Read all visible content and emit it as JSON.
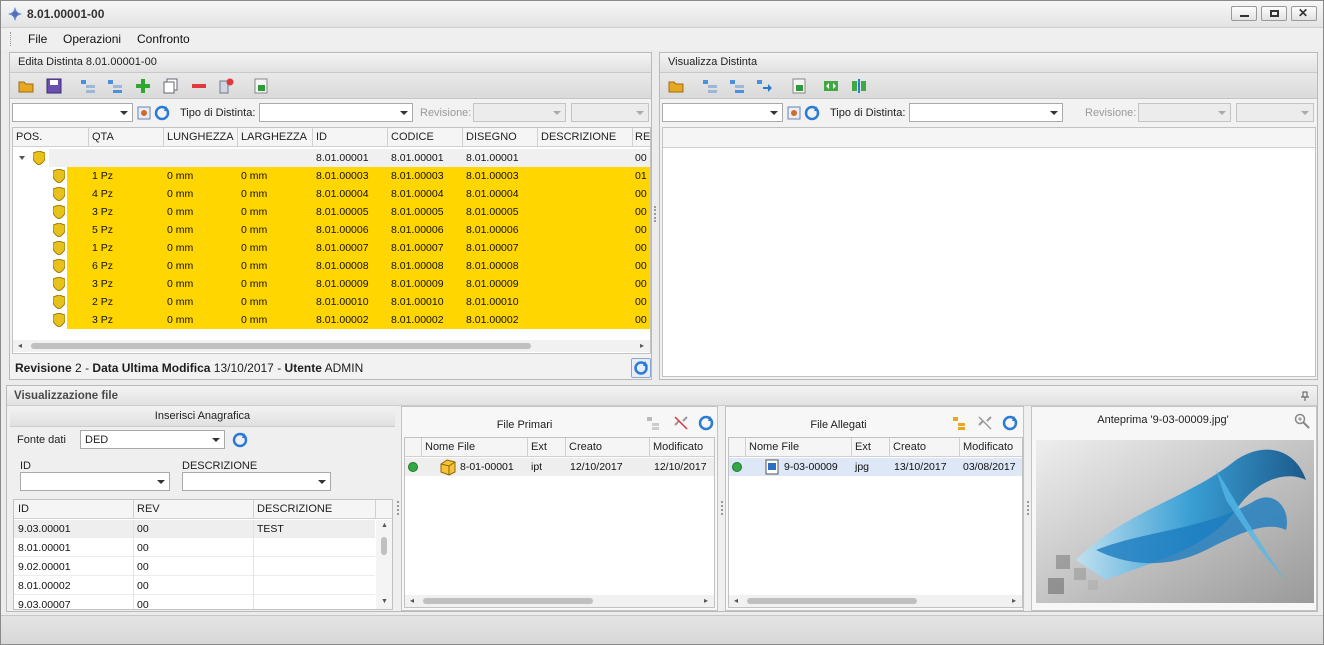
{
  "window": {
    "title": "8.01.00001-00"
  },
  "menu": [
    "File",
    "Operazioni",
    "Confronto"
  ],
  "left_panel": {
    "title": "Edita Distinta 8.01.00001-00",
    "tipo_label": "Tipo di Distinta:",
    "revisione_label": "Revisione:",
    "columns": [
      "POS.",
      "QTA",
      "LUNGHEZZA",
      "LARGHEZZA",
      "ID",
      "CODICE",
      "DISEGNO",
      "DESCRIZIONE",
      "REV"
    ],
    "root": {
      "id": "8.01.00001",
      "codice": "8.01.00001",
      "disegno": "8.01.00001",
      "rev": "00"
    },
    "rows": [
      {
        "qta": "1 Pz",
        "lung": "0 mm",
        "larg": "0 mm",
        "id": "8.01.00003",
        "codice": "8.01.00003",
        "disegno": "8.01.00003",
        "rev": "01"
      },
      {
        "qta": "4 Pz",
        "lung": "0 mm",
        "larg": "0 mm",
        "id": "8.01.00004",
        "codice": "8.01.00004",
        "disegno": "8.01.00004",
        "rev": "00"
      },
      {
        "qta": "3 Pz",
        "lung": "0 mm",
        "larg": "0 mm",
        "id": "8.01.00005",
        "codice": "8.01.00005",
        "disegno": "8.01.00005",
        "rev": "00"
      },
      {
        "qta": "5 Pz",
        "lung": "0 mm",
        "larg": "0 mm",
        "id": "8.01.00006",
        "codice": "8.01.00006",
        "disegno": "8.01.00006",
        "rev": "00"
      },
      {
        "qta": "1 Pz",
        "lung": "0 mm",
        "larg": "0 mm",
        "id": "8.01.00007",
        "codice": "8.01.00007",
        "disegno": "8.01.00007",
        "rev": "00"
      },
      {
        "qta": "6 Pz",
        "lung": "0 mm",
        "larg": "0 mm",
        "id": "8.01.00008",
        "codice": "8.01.00008",
        "disegno": "8.01.00008",
        "rev": "00"
      },
      {
        "qta": "3 Pz",
        "lung": "0 mm",
        "larg": "0 mm",
        "id": "8.01.00009",
        "codice": "8.01.00009",
        "disegno": "8.01.00009",
        "rev": "00"
      },
      {
        "qta": "2 Pz",
        "lung": "0 mm",
        "larg": "0 mm",
        "id": "8.01.00010",
        "codice": "8.01.00010",
        "disegno": "8.01.00010",
        "rev": "00"
      },
      {
        "qta": "3 Pz",
        "lung": "0 mm",
        "larg": "0 mm",
        "id": "8.01.00002",
        "codice": "8.01.00002",
        "disegno": "8.01.00002",
        "rev": "00"
      }
    ],
    "status": {
      "rev_label": "Revisione",
      "rev_value": "2",
      "date_label": "Data Ultima Modifica",
      "date_value": "13/10/2017",
      "user_label": "Utente",
      "user_value": "ADMIN",
      "sep": "-"
    }
  },
  "right_panel": {
    "title": "Visualizza Distinta",
    "tipo_label": "Tipo di Distinta:",
    "revisione_label": "Revisione:"
  },
  "file_section": {
    "title": "Visualizzazione file",
    "anagrafica": {
      "title": "Inserisci Anagrafica",
      "fonte_label": "Fonte dati",
      "fonte_value": "DED",
      "id_label": "ID",
      "desc_label": "DESCRIZIONE",
      "columns": [
        "ID",
        "REV",
        "DESCRIZIONE"
      ],
      "rows": [
        {
          "id": "9.03.00001",
          "rev": "00",
          "desc": "TEST"
        },
        {
          "id": "8.01.00001",
          "rev": "00",
          "desc": ""
        },
        {
          "id": "9.02.00001",
          "rev": "00",
          "desc": ""
        },
        {
          "id": "8.01.00002",
          "rev": "00",
          "desc": ""
        },
        {
          "id": "9.03.00007",
          "rev": "00",
          "desc": ""
        }
      ]
    },
    "primari": {
      "title": "File Primari",
      "columns": [
        "Nome File",
        "Ext",
        "Creato",
        "Modificato"
      ],
      "rows": [
        {
          "name": "8-01-00001",
          "ext": "ipt",
          "creato": "12/10/2017",
          "modificato": "12/10/2017"
        }
      ]
    },
    "allegati": {
      "title": "File Allegati",
      "columns": [
        "Nome File",
        "Ext",
        "Creato",
        "Modificato"
      ],
      "rows": [
        {
          "name": "9-03-00009",
          "ext": "jpg",
          "creato": "13/10/2017",
          "modificato": "03/08/2017"
        }
      ]
    },
    "anteprima": {
      "title": "Anteprima '9-03-00009.jpg'"
    }
  },
  "colors": {
    "highlight": "#ffd600",
    "accent": "#2b7bd6",
    "status_green": "#35a845"
  }
}
